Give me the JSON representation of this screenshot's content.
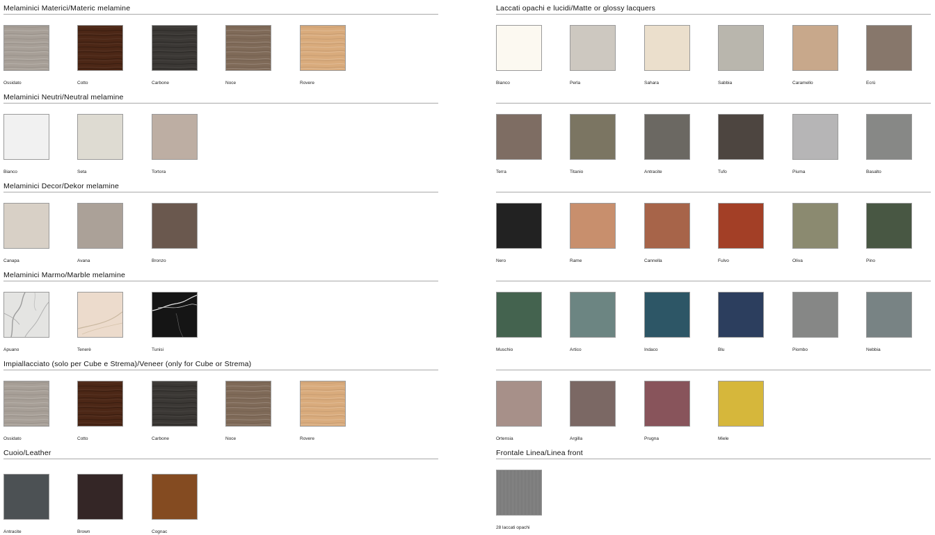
{
  "left": [
    {
      "title": "Melaminici Materici/Materic melamine",
      "items": [
        {
          "name": "Ossidato",
          "color": "#a79f97",
          "texture": "wood-light"
        },
        {
          "name": "Cotto",
          "color": "#4c2716",
          "texture": "wood-dark"
        },
        {
          "name": "Carbone",
          "color": "#3b3835",
          "texture": "wood-dark"
        },
        {
          "name": "Noce",
          "color": "#7f6a58",
          "texture": "wood-light"
        },
        {
          "name": "Rovere",
          "color": "#d9ab7c",
          "texture": "wood-light"
        }
      ]
    },
    {
      "title": "Melaminici Neutri/Neutral melamine",
      "items": [
        {
          "name": "Bianco",
          "color": "#f1f1f1",
          "texture": "plain"
        },
        {
          "name": "Seta",
          "color": "#dedbd2",
          "texture": "plain"
        },
        {
          "name": "Tortora",
          "color": "#bdaea3",
          "texture": "plain"
        }
      ]
    },
    {
      "title": "Melaminici Decor/Dekor melamine",
      "items": [
        {
          "name": "Canapa",
          "color": "#d8d0c6",
          "texture": "plain"
        },
        {
          "name": "Avana",
          "color": "#aba198",
          "texture": "plain"
        },
        {
          "name": "Bronzo",
          "color": "#6a584e",
          "texture": "plain"
        }
      ]
    },
    {
      "title": "Melaminici Marmo/Marble melamine",
      "items": [
        {
          "name": "Apuano",
          "color": "#e4e4e2",
          "texture": "marble-white"
        },
        {
          "name": "Tenerè",
          "color": "#ecdbcc",
          "texture": "marble-cream"
        },
        {
          "name": "Tunisi",
          "color": "#151515",
          "texture": "marble-black"
        }
      ]
    },
    {
      "title": "Impiallacciato (solo per Cube e Strema)/Veneer (only for Cube or Strema)",
      "items": [
        {
          "name": "Ossidato",
          "color": "#a79f97",
          "texture": "wood-light"
        },
        {
          "name": "Cotto",
          "color": "#4c2716",
          "texture": "wood-dark"
        },
        {
          "name": "Carbone",
          "color": "#3b3835",
          "texture": "wood-dark"
        },
        {
          "name": "Noce",
          "color": "#7f6a58",
          "texture": "wood-light"
        },
        {
          "name": "Rovere",
          "color": "#d9ab7c",
          "texture": "wood-light"
        }
      ]
    },
    {
      "title": "Cuoio/Leather",
      "items": [
        {
          "name": "Antracite",
          "color": "#4c5154",
          "texture": "plain"
        },
        {
          "name": "Brown",
          "color": "#342626",
          "texture": "plain"
        },
        {
          "name": "Cognac",
          "color": "#844b21",
          "texture": "plain"
        }
      ]
    }
  ],
  "right": [
    {
      "title": "Laccati opachi e lucidi/Matte or glossy lacquers",
      "items": [
        {
          "name": "Bianco",
          "color": "#fcf9f1",
          "texture": "plain"
        },
        {
          "name": "Perla",
          "color": "#cdc8c0",
          "texture": "plain"
        },
        {
          "name": "Sahara",
          "color": "#ebdfcc",
          "texture": "plain"
        },
        {
          "name": "Sabbia",
          "color": "#b9b6ad",
          "texture": "plain"
        },
        {
          "name": "Caramello",
          "color": "#c8a88b",
          "texture": "plain"
        },
        {
          "name": "Ecrù",
          "color": "#87776b",
          "texture": "plain"
        }
      ]
    },
    {
      "title": "",
      "items": [
        {
          "name": "Terra",
          "color": "#7e6d63",
          "texture": "plain"
        },
        {
          "name": "Titanio",
          "color": "#7b7562",
          "texture": "plain"
        },
        {
          "name": "Antracite",
          "color": "#6b6862",
          "texture": "plain"
        },
        {
          "name": "Tufo",
          "color": "#4d4540",
          "texture": "plain"
        },
        {
          "name": "Piuma",
          "color": "#b6b5b6",
          "texture": "plain"
        },
        {
          "name": "Basalto",
          "color": "#878886",
          "texture": "plain"
        }
      ]
    },
    {
      "title": "",
      "items": [
        {
          "name": "Nero",
          "color": "#222222",
          "texture": "plain"
        },
        {
          "name": "Rame",
          "color": "#c88f6d",
          "texture": "plain"
        },
        {
          "name": "Cannella",
          "color": "#a76449",
          "texture": "plain"
        },
        {
          "name": "Fulvo",
          "color": "#a33f26",
          "texture": "plain"
        },
        {
          "name": "Oliva",
          "color": "#8b8a70",
          "texture": "plain"
        },
        {
          "name": "Pino",
          "color": "#485743",
          "texture": "plain"
        }
      ]
    },
    {
      "title": "",
      "items": [
        {
          "name": "Muschio",
          "color": "#44634f",
          "texture": "plain"
        },
        {
          "name": "Artico",
          "color": "#6c8582",
          "texture": "plain"
        },
        {
          "name": "Indaco",
          "color": "#2d5666",
          "texture": "plain"
        },
        {
          "name": "Blu",
          "color": "#2c3e5e",
          "texture": "plain"
        },
        {
          "name": "Piombo",
          "color": "#868786",
          "texture": "plain"
        },
        {
          "name": "Nebbia",
          "color": "#788384",
          "texture": "plain"
        }
      ]
    },
    {
      "title": "",
      "items": [
        {
          "name": "Ortensia",
          "color": "#a79089",
          "texture": "plain"
        },
        {
          "name": "Argilla",
          "color": "#7b6864",
          "texture": "plain"
        },
        {
          "name": "Prugna",
          "color": "#88545b",
          "texture": "plain"
        },
        {
          "name": "Miele",
          "color": "#d6b73b",
          "texture": "plain"
        }
      ]
    },
    {
      "title": "Frontale Linea/Linea front",
      "items": [
        {
          "name": "28 laccati opachi",
          "color": "#8d8d8d",
          "texture": "lines"
        }
      ]
    }
  ]
}
